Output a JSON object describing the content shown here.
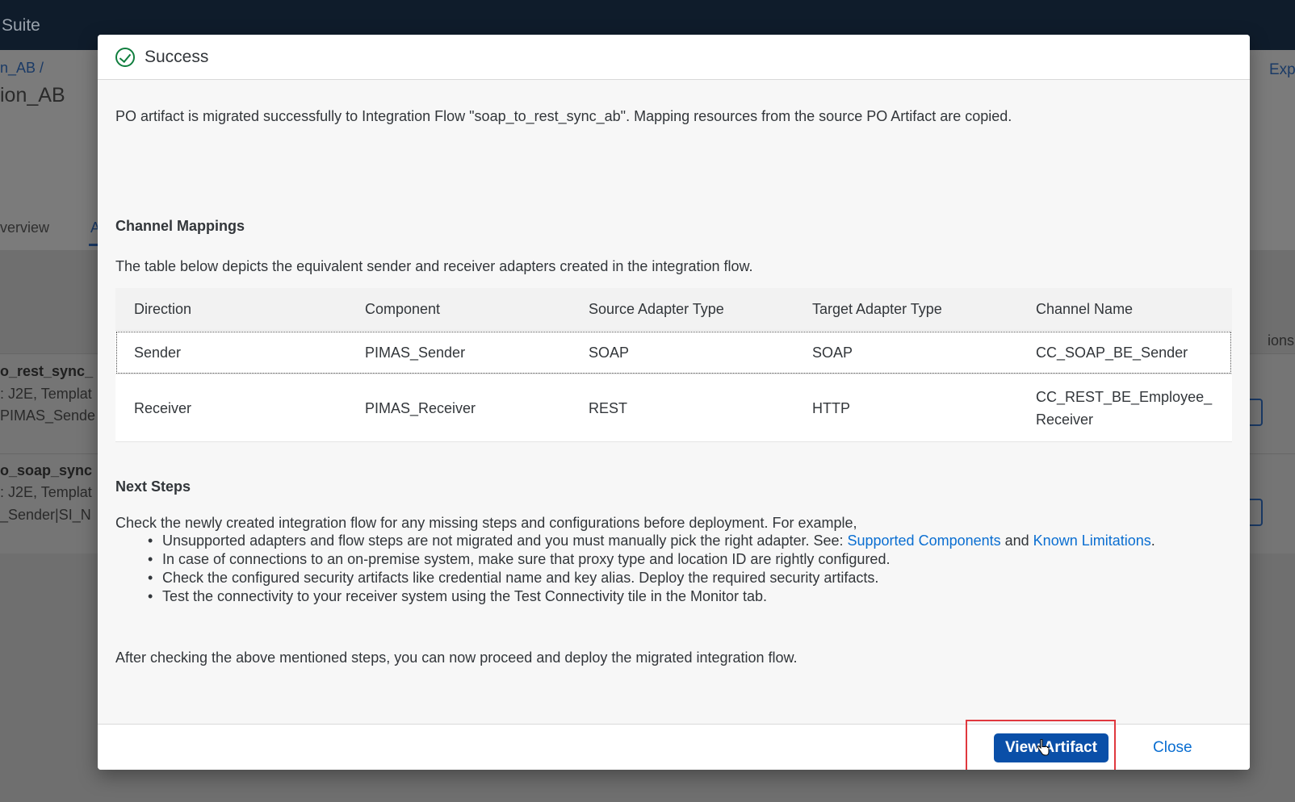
{
  "background": {
    "shell_title": "Suite",
    "breadcrumb": "n_AB /",
    "page_title": "ion_AB",
    "right_link": "Exp",
    "tab_overview": "verview",
    "tab_active": "A",
    "side_text": "ions",
    "rows": [
      {
        "title": "o_rest_sync_",
        "line1": ": J2E, Templat",
        "line2": "PIMAS_Sende"
      },
      {
        "title": "o_soap_sync",
        "line1": ": J2E, Templat",
        "line2": "_Sender|SI_N"
      }
    ]
  },
  "dialog": {
    "title": "Success",
    "intro": "PO artifact is migrated successfully to Integration Flow \"soap_to_rest_sync_ab\". Mapping resources from the source PO Artifact are copied.",
    "channel_mappings_title": "Channel Mappings",
    "table_description": "The table below depicts the equivalent sender and receiver adapters created in the integration flow.",
    "table": {
      "headers": [
        "Direction",
        "Component",
        "Source Adapter Type",
        "Target Adapter Type",
        "Channel Name"
      ],
      "rows": [
        [
          "Sender",
          "PIMAS_Sender",
          "SOAP",
          "SOAP",
          "CC_SOAP_BE_Sender"
        ],
        [
          "Receiver",
          "PIMAS_Receiver",
          "REST",
          "HTTP",
          "CC_REST_BE_Employee_Receiver"
        ]
      ]
    },
    "next_steps_title": "Next Steps",
    "next_steps_intro": "Check the newly created integration flow for any missing steps and configurations before deployment. For example,",
    "steps": {
      "s1_text": "Unsupported adapters and flow steps are not migrated and you must manually pick the right adapter. See: ",
      "s1_link1": "Supported Components",
      "s1_and": " and ",
      "s1_link2": "Known Limitations",
      "s1_end": ".",
      "s2": "In case of connections to an on-premise system, make sure that proxy type and location ID are rightly configured.",
      "s3": "Check the configured security artifacts like credential name and key alias. Deploy the required security artifacts.",
      "s4": "Test the connectivity to your receiver system using the Test Connectivity tile in the Monitor tab."
    },
    "after": "After checking the above mentioned steps, you can now proceed and deploy the migrated integration flow.",
    "view_artifact_label": "View Artifact",
    "close_label": "Close"
  },
  "colors": {
    "primary": "#0a4fa8",
    "link": "#0a6ed1",
    "success": "#107e3e",
    "highlight": "#e0383e"
  },
  "icons": {
    "success": "check-circle-icon",
    "cursor": "hand-pointer-icon"
  }
}
